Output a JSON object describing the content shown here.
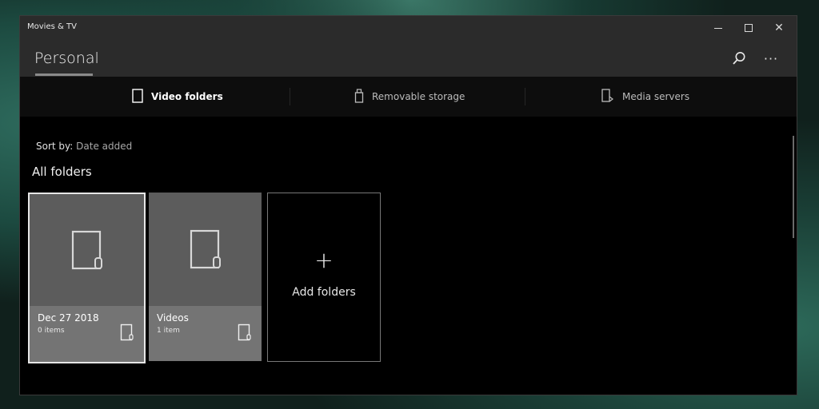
{
  "window": {
    "app_title": "Movies & TV"
  },
  "header": {
    "title": "Personal"
  },
  "tabs": [
    {
      "label": "Video folders",
      "icon": "tablet-icon",
      "active": true
    },
    {
      "label": "Removable storage",
      "icon": "usb-drive-icon",
      "active": false
    },
    {
      "label": "Media servers",
      "icon": "media-server-icon",
      "active": false
    }
  ],
  "sort": {
    "label": "Sort by:",
    "value": "Date added"
  },
  "section": {
    "title": "All folders"
  },
  "folders": [
    {
      "name": "Dec 27 2018",
      "count": "0 items"
    },
    {
      "name": "Videos",
      "count": "1 item"
    }
  ],
  "add_card": {
    "icon": "plus-icon",
    "label": "Add folders"
  },
  "colors": {
    "window_bg": "#000000",
    "titlebar": "#2b2b2b",
    "card_top": "#5c5c5c",
    "card_bottom": "#747474"
  }
}
